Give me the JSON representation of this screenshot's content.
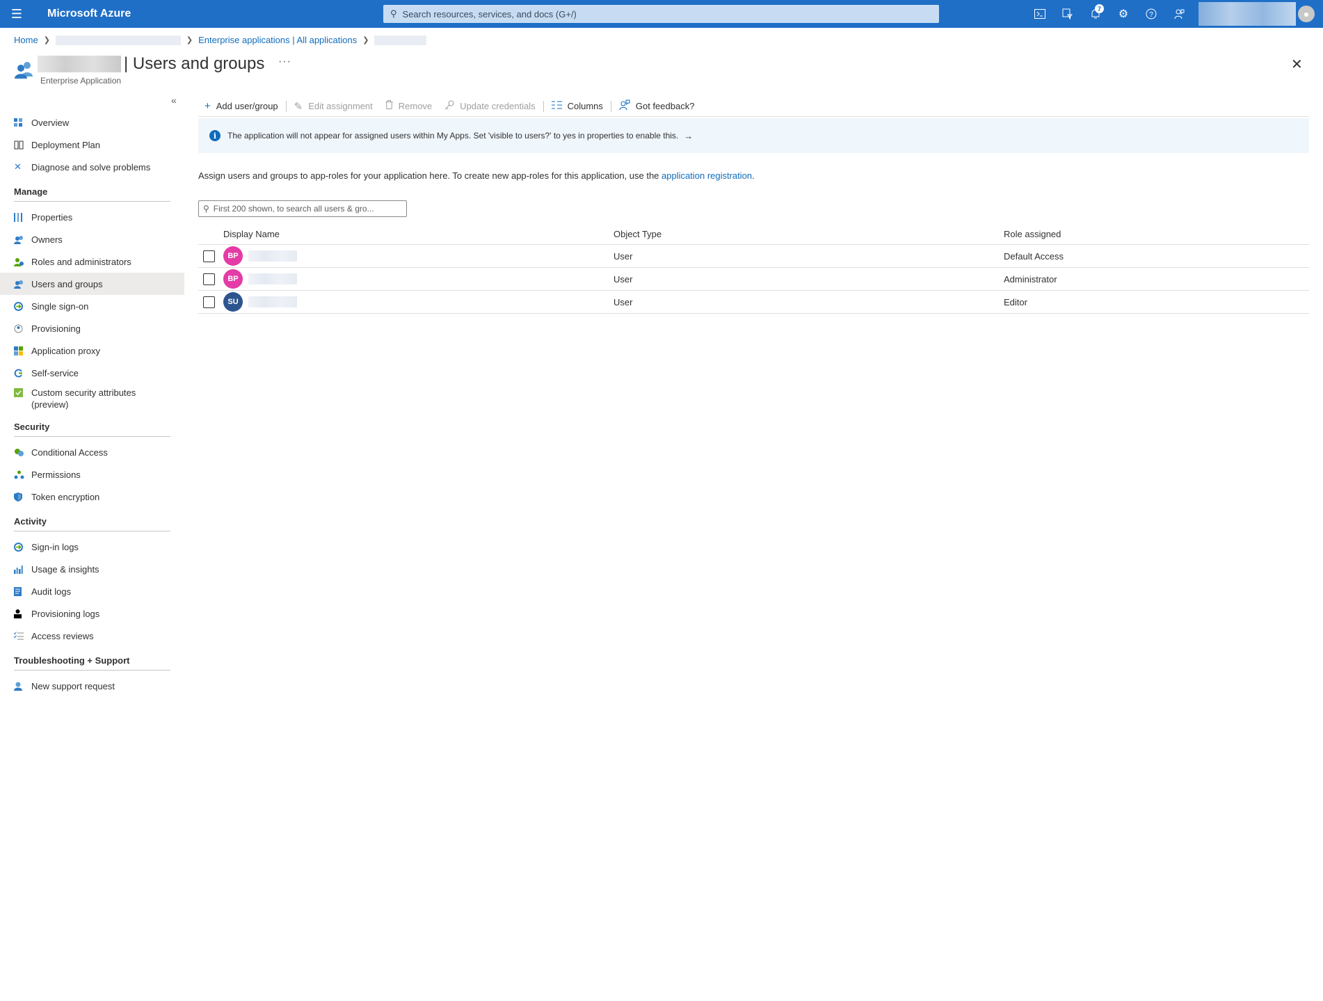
{
  "topbar": {
    "brand": "Microsoft Azure",
    "search_placeholder": "Search resources, services, and docs (G+/)",
    "notification_count": "7"
  },
  "breadcrumb": {
    "home": "Home",
    "enterprise": "Enterprise applications | All applications"
  },
  "header": {
    "title": "| Users and groups",
    "subtitle": "Enterprise Application",
    "more": "···"
  },
  "sidebar": {
    "top_items": [
      {
        "label": "Overview",
        "icon": "grid-icon"
      },
      {
        "label": "Deployment Plan",
        "icon": "book-icon"
      },
      {
        "label": "Diagnose and solve problems",
        "icon": "wrench-icon"
      }
    ],
    "sections": [
      {
        "header": "Manage",
        "items": [
          {
            "label": "Properties",
            "icon": "properties-icon"
          },
          {
            "label": "Owners",
            "icon": "owners-icon"
          },
          {
            "label": "Roles and administrators",
            "icon": "roles-icon"
          },
          {
            "label": "Users and groups",
            "icon": "users-icon",
            "active": true
          },
          {
            "label": "Single sign-on",
            "icon": "sso-icon"
          },
          {
            "label": "Provisioning",
            "icon": "provisioning-icon"
          },
          {
            "label": "Application proxy",
            "icon": "proxy-icon"
          },
          {
            "label": "Self-service",
            "icon": "self-service-icon"
          },
          {
            "label": "Custom security attributes (preview)",
            "icon": "attributes-icon"
          }
        ]
      },
      {
        "header": "Security",
        "items": [
          {
            "label": "Conditional Access",
            "icon": "conditional-access-icon"
          },
          {
            "label": "Permissions",
            "icon": "permissions-icon"
          },
          {
            "label": "Token encryption",
            "icon": "shield-icon"
          }
        ]
      },
      {
        "header": "Activity",
        "items": [
          {
            "label": "Sign-in logs",
            "icon": "signin-icon"
          },
          {
            "label": "Usage & insights",
            "icon": "chart-icon"
          },
          {
            "label": "Audit logs",
            "icon": "audit-icon"
          },
          {
            "label": "Provisioning logs",
            "icon": "person-icon"
          },
          {
            "label": "Access reviews",
            "icon": "list-icon"
          }
        ]
      },
      {
        "header": "Troubleshooting + Support",
        "items": [
          {
            "label": "New support request",
            "icon": "support-icon"
          }
        ]
      }
    ]
  },
  "toolbar": {
    "add": "Add user/group",
    "edit": "Edit assignment",
    "remove": "Remove",
    "update": "Update credentials",
    "columns": "Columns",
    "feedback": "Got feedback?"
  },
  "banner": {
    "text": "The application will not appear for assigned users within My Apps. Set 'visible to users?' to yes in properties to enable this."
  },
  "description": {
    "text": "Assign users and groups to app-roles for your application here. To create new app-roles for this application, use the",
    "link": "application registration",
    "end": "."
  },
  "filter": {
    "placeholder": "First 200 shown, to search all users & gro..."
  },
  "table": {
    "headers": {
      "name": "Display Name",
      "type": "Object Type",
      "role": "Role assigned"
    },
    "rows": [
      {
        "initials": "BP",
        "color": "#e43ba6",
        "type": "User",
        "role": "Default Access"
      },
      {
        "initials": "BP",
        "color": "#e43ba6",
        "type": "User",
        "role": "Administrator"
      },
      {
        "initials": "SU",
        "color": "#2c5590",
        "type": "User",
        "role": "Editor"
      }
    ]
  },
  "colors": {
    "accent": "#0f6cbd",
    "topbar": "#1f6fc7",
    "banner": "#eff6fc"
  }
}
